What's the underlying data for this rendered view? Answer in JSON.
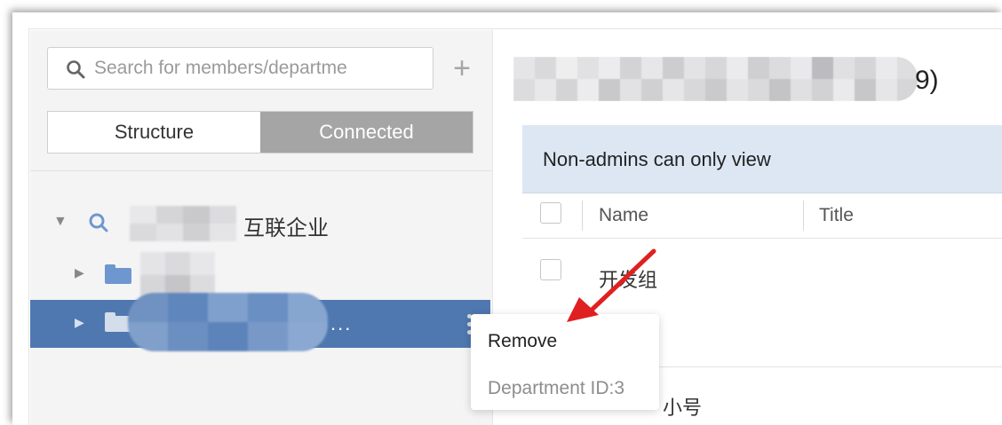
{
  "search": {
    "placeholder": "Search for members/departme",
    "add_icon": "plus-icon"
  },
  "tabs": {
    "structure_label": "Structure",
    "connected_label": "Connected",
    "active": "Connected"
  },
  "tree": {
    "root": {
      "label_visible": "互联企业",
      "expanded": true
    },
    "items": [
      {
        "label_visible": "",
        "selected": false
      },
      {
        "label_visible": "...",
        "selected": true
      }
    ]
  },
  "context_menu": {
    "remove_label": "Remove",
    "department_id_label": "Department ID:3"
  },
  "main": {
    "title_suffix": "9)",
    "notice": "Non-admins can only view",
    "columns": {
      "name": "Name",
      "title": "Title"
    },
    "rows": [
      {
        "name": "开发组"
      },
      {
        "name_partial": "小号"
      }
    ]
  },
  "colors": {
    "selected_row": "#4f78b0",
    "segment_active": "#a5a5a5",
    "notice_bg": "#dde7f4",
    "folder": "#6e97cf",
    "annotation_arrow": "#e02020"
  }
}
